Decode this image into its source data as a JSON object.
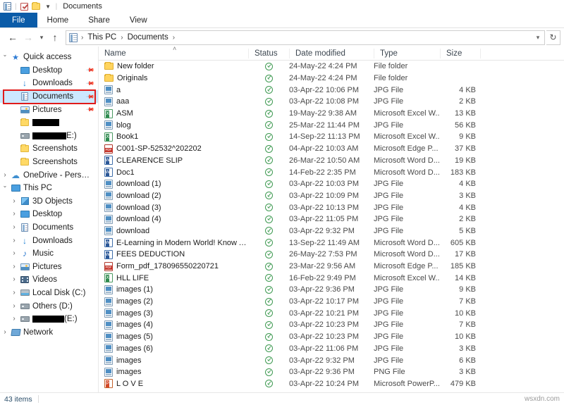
{
  "window": {
    "title": "Documents",
    "quick_access_toolbar": [
      {
        "icon": "properties-icon",
        "name": "properties"
      },
      {
        "icon": "checkmark-icon",
        "name": "check-properties"
      },
      {
        "icon": "folder-icon",
        "name": "new-folder"
      },
      {
        "icon": "chevron-down-icon",
        "name": "customize-qat"
      }
    ]
  },
  "ribbon": {
    "tabs": [
      {
        "label": "File",
        "active": true
      },
      {
        "label": "Home",
        "active": false
      },
      {
        "label": "Share",
        "active": false
      },
      {
        "label": "View",
        "active": false
      }
    ]
  },
  "address_bar": {
    "back_icon": "arrow-left-icon",
    "forward_icon": "arrow-right-icon",
    "recent_icon": "chevron-down-icon",
    "up_icon": "arrow-up-icon",
    "path_icon": "documents-icon",
    "breadcrumbs": [
      "This PC",
      "Documents"
    ],
    "separator": "›",
    "dropdown_icon": "chevron-down-icon",
    "refresh_icon": "refresh-icon"
  },
  "sidebar": {
    "items": [
      {
        "label": "Quick access",
        "icon": "star-icon",
        "chevron": "open",
        "indent": 0,
        "pinned": false,
        "selected": false
      },
      {
        "label": "Desktop",
        "icon": "desktop-icon",
        "chevron": "none",
        "indent": 1,
        "pinned": true,
        "selected": false
      },
      {
        "label": "Downloads",
        "icon": "download-icon",
        "chevron": "none",
        "indent": 1,
        "pinned": true,
        "selected": false
      },
      {
        "label": "Documents",
        "icon": "documents-icon",
        "chevron": "none",
        "indent": 1,
        "pinned": true,
        "selected": true
      },
      {
        "label": "Pictures",
        "icon": "pictures-icon",
        "chevron": "none",
        "indent": 1,
        "pinned": true,
        "selected": false
      },
      {
        "label": "",
        "icon": "folder-icon",
        "chevron": "none",
        "indent": 1,
        "pinned": false,
        "selected": false,
        "redacted": 38
      },
      {
        "label": "E:)",
        "icon": "drive-icon",
        "chevron": "none",
        "indent": 1,
        "pinned": false,
        "selected": false,
        "redacted": 48
      },
      {
        "label": "Screenshots",
        "icon": "folder-icon",
        "chevron": "none",
        "indent": 1,
        "pinned": false,
        "selected": false
      },
      {
        "label": "Screenshots",
        "icon": "folder-icon",
        "chevron": "none",
        "indent": 1,
        "pinned": false,
        "selected": false
      },
      {
        "label": "OneDrive - Personal",
        "icon": "cloud-icon",
        "chevron": "closed",
        "indent": 0,
        "pinned": false,
        "selected": false
      },
      {
        "label": "This PC",
        "icon": "pc-icon",
        "chevron": "open",
        "indent": 0,
        "pinned": false,
        "selected": false
      },
      {
        "label": "3D Objects",
        "icon": "3d-objects-icon",
        "chevron": "closed",
        "indent": 1,
        "pinned": false,
        "selected": false
      },
      {
        "label": "Desktop",
        "icon": "desktop-icon",
        "chevron": "closed",
        "indent": 1,
        "pinned": false,
        "selected": false
      },
      {
        "label": "Documents",
        "icon": "documents-icon",
        "chevron": "closed",
        "indent": 1,
        "pinned": false,
        "selected": false
      },
      {
        "label": "Downloads",
        "icon": "download-icon",
        "chevron": "closed",
        "indent": 1,
        "pinned": false,
        "selected": false
      },
      {
        "label": "Music",
        "icon": "music-icon",
        "chevron": "closed",
        "indent": 1,
        "pinned": false,
        "selected": false
      },
      {
        "label": "Pictures",
        "icon": "pictures-icon",
        "chevron": "closed",
        "indent": 1,
        "pinned": false,
        "selected": false
      },
      {
        "label": "Videos",
        "icon": "videos-icon",
        "chevron": "closed",
        "indent": 1,
        "pinned": false,
        "selected": false
      },
      {
        "label": "Local Disk (C:)",
        "icon": "local-disk-icon",
        "chevron": "closed",
        "indent": 1,
        "pinned": false,
        "selected": false
      },
      {
        "label": "Others (D:)",
        "icon": "drive-icon",
        "chevron": "closed",
        "indent": 1,
        "pinned": false,
        "selected": false
      },
      {
        "label": "(E:)",
        "icon": "drive-icon",
        "chevron": "closed",
        "indent": 1,
        "pinned": false,
        "selected": false,
        "redacted": 45
      },
      {
        "label": "Network",
        "icon": "network-icon",
        "chevron": "closed",
        "indent": 0,
        "pinned": false,
        "selected": false
      }
    ],
    "highlight_color": "#e01b1b",
    "selection_color": "#cce8ff"
  },
  "file_list": {
    "columns": [
      {
        "label": "Name",
        "sorted": "ascending"
      },
      {
        "label": "Status"
      },
      {
        "label": "Date modified"
      },
      {
        "label": "Type"
      },
      {
        "label": "Size"
      }
    ],
    "sort_indicator": "˄",
    "status_icon": "sync-complete-icon",
    "rows": [
      {
        "name": "New folder",
        "icon": "folder-icon",
        "date": "24-May-22 4:24 PM",
        "type": "File folder",
        "size": ""
      },
      {
        "name": "Originals",
        "icon": "folder-icon",
        "date": "24-May-22 4:24 PM",
        "type": "File folder",
        "size": ""
      },
      {
        "name": "a",
        "icon": "jpg-icon",
        "date": "03-Apr-22 10:06 PM",
        "type": "JPG File",
        "size": "4 KB"
      },
      {
        "name": "aaa",
        "icon": "jpg-icon",
        "date": "03-Apr-22 10:08 PM",
        "type": "JPG File",
        "size": "2 KB"
      },
      {
        "name": "ASM",
        "icon": "excel-icon",
        "date": "19-May-22 9:38 AM",
        "type": "Microsoft Excel W...",
        "size": "13 KB"
      },
      {
        "name": "blog",
        "icon": "jpg-icon",
        "date": "25-Mar-22 11:44 PM",
        "type": "JPG File",
        "size": "56 KB"
      },
      {
        "name": "Book1",
        "icon": "excel-icon",
        "date": "14-Sep-22 11:13 PM",
        "type": "Microsoft Excel W...",
        "size": "9 KB"
      },
      {
        "name": "C001-SP-52532^202202",
        "icon": "pdf-icon",
        "date": "04-Apr-22 10:03 AM",
        "type": "Microsoft Edge P...",
        "size": "37 KB"
      },
      {
        "name": "CLEARENCE SLIP",
        "icon": "word-icon",
        "date": "26-Mar-22 10:50 AM",
        "type": "Microsoft Word D...",
        "size": "19 KB"
      },
      {
        "name": "Doc1",
        "icon": "word-icon",
        "date": "14-Feb-22 2:35 PM",
        "type": "Microsoft Word D...",
        "size": "183 KB"
      },
      {
        "name": "download (1)",
        "icon": "jpg-icon",
        "date": "03-Apr-22 10:03 PM",
        "type": "JPG File",
        "size": "4 KB"
      },
      {
        "name": "download (2)",
        "icon": "jpg-icon",
        "date": "03-Apr-22 10:09 PM",
        "type": "JPG File",
        "size": "3 KB"
      },
      {
        "name": "download (3)",
        "icon": "jpg-icon",
        "date": "03-Apr-22 10:13 PM",
        "type": "JPG File",
        "size": "4 KB"
      },
      {
        "name": "download (4)",
        "icon": "jpg-icon",
        "date": "03-Apr-22 11:05 PM",
        "type": "JPG File",
        "size": "2 KB"
      },
      {
        "name": "download",
        "icon": "jpg-icon",
        "date": "03-Apr-22 9:32 PM",
        "type": "JPG File",
        "size": "5 KB"
      },
      {
        "name": "E-Learning in Modern World! Know All th...",
        "icon": "word-icon",
        "date": "13-Sep-22 11:49 AM",
        "type": "Microsoft Word D...",
        "size": "605 KB"
      },
      {
        "name": "FEES DEDUCTION",
        "icon": "word-icon",
        "date": "26-May-22 7:53 PM",
        "type": "Microsoft Word D...",
        "size": "17 KB"
      },
      {
        "name": "Form_pdf_178096550220721",
        "icon": "pdf-icon",
        "date": "23-Mar-22 9:56 AM",
        "type": "Microsoft Edge P...",
        "size": "185 KB"
      },
      {
        "name": "HLL LIFE",
        "icon": "excel-icon",
        "date": "16-Feb-22 9:49 PM",
        "type": "Microsoft Excel W...",
        "size": "14 KB"
      },
      {
        "name": "images (1)",
        "icon": "jpg-icon",
        "date": "03-Apr-22 9:36 PM",
        "type": "JPG File",
        "size": "9 KB"
      },
      {
        "name": "images (2)",
        "icon": "jpg-icon",
        "date": "03-Apr-22 10:17 PM",
        "type": "JPG File",
        "size": "7 KB"
      },
      {
        "name": "images (3)",
        "icon": "jpg-icon",
        "date": "03-Apr-22 10:21 PM",
        "type": "JPG File",
        "size": "10 KB"
      },
      {
        "name": "images (4)",
        "icon": "jpg-icon",
        "date": "03-Apr-22 10:23 PM",
        "type": "JPG File",
        "size": "7 KB"
      },
      {
        "name": "images (5)",
        "icon": "jpg-icon",
        "date": "03-Apr-22 10:23 PM",
        "type": "JPG File",
        "size": "10 KB"
      },
      {
        "name": "images (6)",
        "icon": "jpg-icon",
        "date": "03-Apr-22 11:06 PM",
        "type": "JPG File",
        "size": "3 KB"
      },
      {
        "name": "images",
        "icon": "jpg-icon",
        "date": "03-Apr-22 9:32 PM",
        "type": "JPG File",
        "size": "6 KB"
      },
      {
        "name": "images",
        "icon": "jpg-icon",
        "date": "03-Apr-22 9:36 PM",
        "type": "PNG File",
        "size": "3 KB"
      },
      {
        "name": "L O V E",
        "icon": "powerpoint-icon",
        "date": "03-Apr-22 10:24 PM",
        "type": "Microsoft PowerP...",
        "size": "479 KB"
      }
    ]
  },
  "status_bar": {
    "item_count": "43 items",
    "watermark": "wsxdn.com"
  }
}
